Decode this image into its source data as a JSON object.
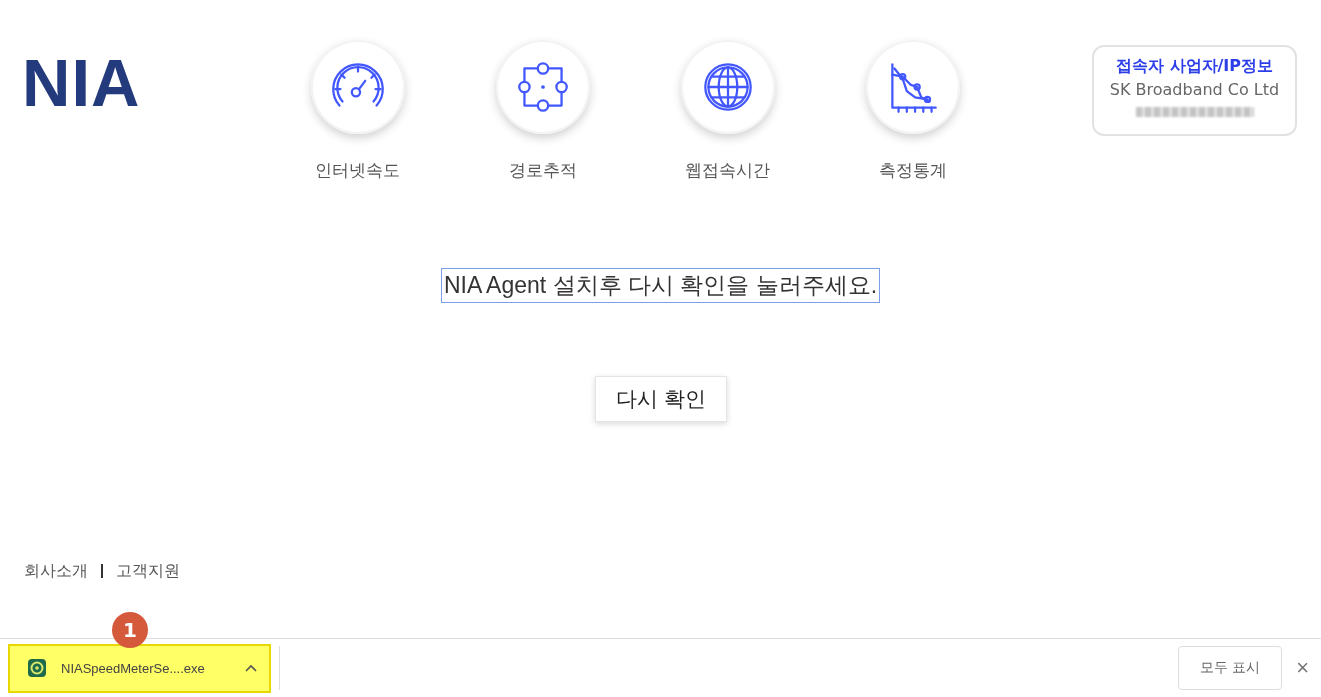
{
  "logo": {
    "text": "NIA"
  },
  "nav": [
    {
      "label": "인터넷속도",
      "kind": "speed"
    },
    {
      "label": "경로추적",
      "kind": "route"
    },
    {
      "label": "웹접속시간",
      "kind": "globe"
    },
    {
      "label": "측정통계",
      "kind": "stats"
    }
  ],
  "connection_info": {
    "title": "접속자 사업자/IP정보",
    "isp": "SK Broadband Co Ltd",
    "ip_redacted": true
  },
  "message": {
    "text": "NIA Agent 설치후 다시 확인을 눌러주세요.",
    "focused": true
  },
  "retry_button": "다시 확인",
  "footer_links": [
    "회사소개",
    "고객지원"
  ],
  "download_bar": {
    "items": [
      {
        "file_name": "NIASpeedMeterSe....exe",
        "highlighted": true,
        "annotation": "1"
      }
    ],
    "show_all_button": "모두 표시",
    "close": "×"
  }
}
